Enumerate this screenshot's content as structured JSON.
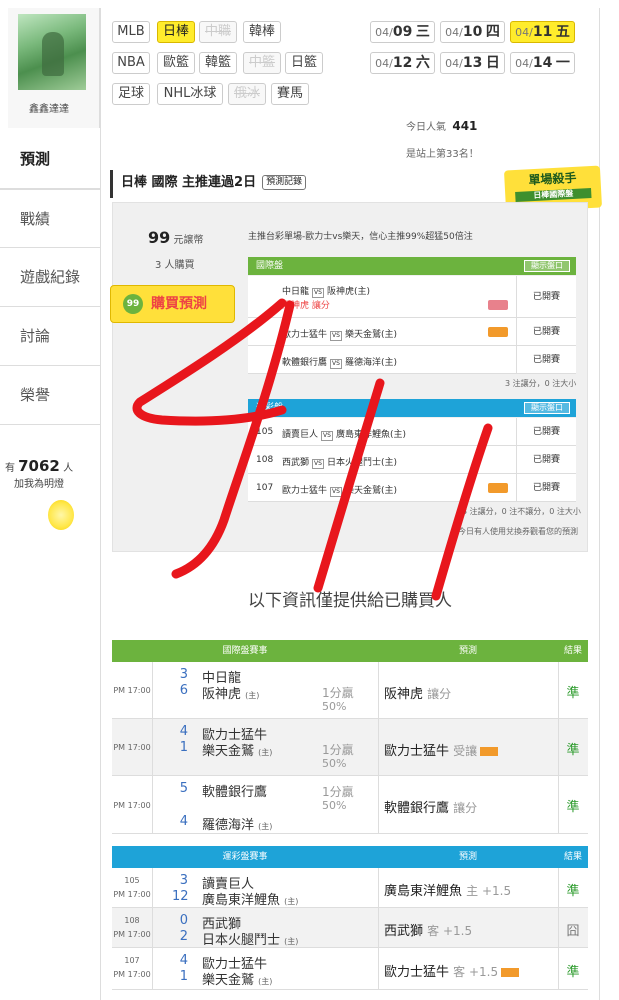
{
  "sidebar": {
    "username": "鑫鑫達達",
    "items": [
      {
        "label": "預測",
        "active": true
      },
      {
        "label": "戰績"
      },
      {
        "label": "遊戲紀錄"
      },
      {
        "label": "討論"
      },
      {
        "label": "榮譽"
      }
    ],
    "fans_prefix": "有",
    "fans_count": "7062",
    "fans_suffix": "人",
    "fans_cta": "加我為明燈"
  },
  "sports": [
    {
      "label": "MLB"
    },
    {
      "label": "日棒",
      "selected": true
    },
    {
      "label": "中職",
      "disabled": true
    },
    {
      "label": "韓棒"
    },
    {
      "label": "NBA"
    },
    {
      "label": "歐籃"
    },
    {
      "label": "韓籃"
    },
    {
      "label": "中籃",
      "disabled": true
    },
    {
      "label": "日籃"
    },
    {
      "label": "足球"
    },
    {
      "label": "NHL冰球"
    },
    {
      "label": "俄冰",
      "disabled": true
    },
    {
      "label": "賽馬"
    }
  ],
  "dates": [
    {
      "md": "04/",
      "d": "09",
      "w": "三"
    },
    {
      "md": "04/",
      "d": "10",
      "w": "四"
    },
    {
      "md": "04/",
      "d": "11",
      "w": "五",
      "selected": true
    },
    {
      "md": "04/",
      "d": "12",
      "w": "六"
    },
    {
      "md": "04/",
      "d": "13",
      "w": "日"
    },
    {
      "md": "04/",
      "d": "14",
      "w": "一"
    }
  ],
  "popularity": {
    "label": "今日人氣",
    "value": "441",
    "rank_text": "是站上第33名！"
  },
  "header": {
    "title": "日棒 國際 主推連過2日",
    "record_button": "預測記錄",
    "badge_title": "單場殺手",
    "badge_sub": "日棒國際盤"
  },
  "purchase": {
    "price": "99",
    "price_unit": "元譲幣",
    "buyers": "3 人購買",
    "buy_label": "購買預測",
    "buy_icon": "99",
    "description": "主推台彩單場-歐力士vs樂天，信心主推99%超猛50倍注"
  },
  "intl_group": {
    "title": "國際盤",
    "show_button": "顯示盤口",
    "rows": [
      {
        "away": "中日龍",
        "home": "阪神虎(主)",
        "pick": "阪神虎  讓分",
        "result": "已開賽"
      },
      {
        "away": "歐力士猛牛",
        "home": "樂天金鷲(主)",
        "result": "已開賽"
      },
      {
        "away": "軟體銀行鷹",
        "home": "羅德海洋(主)",
        "result": "已開賽"
      }
    ],
    "summary": "3 注讓分，0 注大小"
  },
  "lottery_group": {
    "title": "運彩盤",
    "show_button": "顯示盤口",
    "rows": [
      {
        "num": "105",
        "away": "讀賣巨人",
        "home": "廣島東洋鯉魚(主)",
        "result": "已開賽"
      },
      {
        "num": "108",
        "away": "西武獅",
        "home": "日本火腿鬥士(主)",
        "result": "已開賽"
      },
      {
        "num": "107",
        "away": "歐力士猛牛",
        "home": "樂天金鷲(主)",
        "result": "已開賽"
      }
    ],
    "summary": "3 注讓分，0 注不讓分，0 注大小",
    "coupon_note": "今日有人使用兌換券觀看您的預測"
  },
  "notice": "以下資訊僅提供給已購買人",
  "intl_table": {
    "header": "國際盤賽事",
    "pick_header": "預測",
    "result_header": "結果",
    "rows": [
      {
        "time": "PM 17:00",
        "s1": "3",
        "t1": "中日龍",
        "s2": "6",
        "t2": "阪神虎",
        "home": "(主)",
        "line1": "1分贏",
        "line2": "50%",
        "pick": "阪神虎",
        "pick_type": "讓分",
        "result": "準"
      },
      {
        "time": "PM 17:00",
        "s1": "4",
        "t1": "歐力士猛牛",
        "s2": "1",
        "t2": "樂天金鷲",
        "home": "(主)",
        "line1": "1分贏",
        "line2": "50%",
        "pick": "歐力士猛牛",
        "pick_type": "受讓",
        "result": "準"
      },
      {
        "time": "PM 17:00",
        "s1": "5",
        "t1": "軟體銀行鷹",
        "s2": "4",
        "t2": "羅德海洋",
        "home": "(主)",
        "line1": "1分贏",
        "line2": "50%",
        "pick": "軟體銀行鷹",
        "pick_type": "讓分",
        "result": "準"
      }
    ]
  },
  "lottery_table": {
    "header": "運彩盤賽事",
    "pick_header": "預測",
    "result_header": "結果",
    "rows": [
      {
        "num": "105",
        "time": "PM 17:00",
        "s1": "3",
        "t1": "讀賣巨人",
        "s2": "12",
        "t2": "廣島東洋鯉魚",
        "home": "(主)",
        "pick": "廣島東洋鯉魚",
        "pick_type": "主 +1.5",
        "result": "準"
      },
      {
        "num": "108",
        "time": "PM 17:00",
        "s1": "0",
        "t1": "西武獅",
        "s2": "2",
        "t2": "日本火腿鬥士",
        "home": "(主)",
        "pick": "西武獅",
        "pick_type": "客 +1.5",
        "result": "囧"
      },
      {
        "num": "107",
        "time": "PM 17:00",
        "s1": "4",
        "t1": "歐力士猛牛",
        "s2": "1",
        "t2": "樂天金鷲",
        "home": "(主)",
        "pick": "歐力士猛牛",
        "pick_type": "客 +1.5",
        "result": "準"
      }
    ]
  },
  "colors": {
    "green": "#6cb33e",
    "blue": "#1ea3d8",
    "yellow": "#ffe03a",
    "scribble": "#e8161c"
  }
}
